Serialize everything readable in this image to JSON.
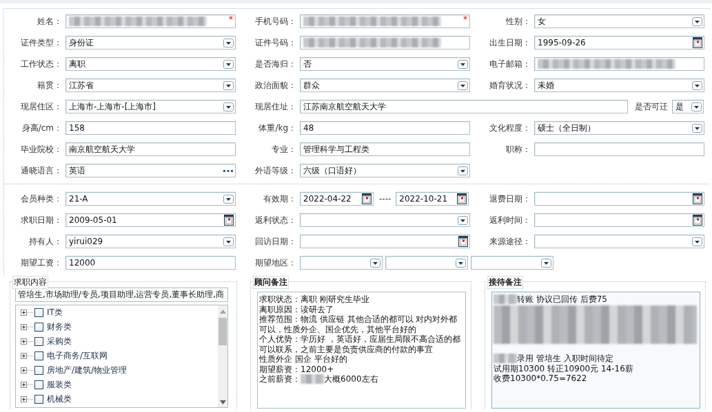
{
  "sections": [
    {
      "rows": [
        {
          "fields": [
            {
              "kind": "text",
              "label": "姓名：",
              "blurred": true,
              "required_mark": "*"
            },
            {
              "kind": "text",
              "label": "手机号码：",
              "blurred": true,
              "required_mark": "*"
            },
            {
              "kind": "select",
              "label": "性别：",
              "value": "女"
            }
          ]
        },
        {
          "fields": [
            {
              "kind": "select",
              "label": "证件类型：",
              "value": "身份证"
            },
            {
              "kind": "text",
              "label": "证件号码：",
              "blurred": true
            },
            {
              "kind": "date",
              "label": "出生日期：",
              "value": "1995-09-26"
            }
          ]
        },
        {
          "fields": [
            {
              "kind": "select",
              "label": "工作状态：",
              "value": "离职"
            },
            {
              "kind": "select",
              "label": "是否海归：",
              "value": "否"
            },
            {
              "kind": "text",
              "label": "电子邮箱：",
              "blurred": true
            }
          ]
        },
        {
          "fields": [
            {
              "kind": "select",
              "label": "籍贯：",
              "value": "江苏省"
            },
            {
              "kind": "select",
              "label": "政治面貌：",
              "value": "群众"
            },
            {
              "kind": "select",
              "label": "婚育状况：",
              "value": "未婚"
            }
          ]
        },
        {
          "fields": [
            {
              "kind": "select",
              "label": "现居住区：",
              "value": "上海市-上海市-[上海市]"
            },
            {
              "kind": "wide-text",
              "label": "现居住址：",
              "value": "江苏南京航空航天大学"
            },
            {
              "kind": "mini-select",
              "label": "是否可迁",
              "value": "是"
            }
          ]
        },
        {
          "fields": [
            {
              "kind": "text",
              "label": "身高/cm：",
              "value": "158"
            },
            {
              "kind": "text",
              "label": "体重/kg：",
              "value": "48"
            },
            {
              "kind": "select",
              "label": "文化程度：",
              "value": "硕士（全日制）"
            }
          ]
        },
        {
          "fields": [
            {
              "kind": "text",
              "label": "毕业院校：",
              "value": "南京航空航天大学"
            },
            {
              "kind": "text",
              "label": "专业：",
              "value": "管理科学与工程类"
            },
            {
              "kind": "text",
              "label": "职称："
            }
          ]
        },
        {
          "fields": [
            {
              "kind": "lookup",
              "label": "通晓语言：",
              "value": "英语"
            },
            {
              "kind": "select",
              "label": "外语等级：",
              "value": "六级（口语好）"
            }
          ]
        }
      ]
    },
    {
      "rows": [
        {
          "fields": [
            {
              "kind": "select",
              "label": "会员种类：",
              "value": "21-A"
            },
            {
              "kind": "date-range",
              "label": "有效期：",
              "value": "2022-04-22",
              "separator": "----",
              "value_end": "2022-10-21"
            },
            {
              "kind": "date",
              "label": "退费日期："
            }
          ]
        },
        {
          "fields": [
            {
              "kind": "date",
              "label": "求职日期：",
              "value": "2009-05-01"
            },
            {
              "kind": "select",
              "label": "返利状态："
            },
            {
              "kind": "date",
              "label": "返利时间："
            }
          ]
        },
        {
          "fields": [
            {
              "kind": "select",
              "label": "持有人：",
              "value": "yirui029"
            },
            {
              "kind": "date",
              "label": "回访日期："
            },
            {
              "kind": "select",
              "label": "来源途径："
            }
          ]
        },
        {
          "fields": [
            {
              "kind": "text",
              "label": "期望工资：",
              "value": "12000"
            },
            {
              "kind": "region",
              "label": "期望地区：",
              "parts": [
                {
                  "kind": "select"
                },
                {
                  "kind": "select"
                },
                {
                  "kind": "select"
                }
              ]
            }
          ]
        }
      ]
    }
  ],
  "job_panel": {
    "legend": "求职内容",
    "summary": "管培生,市场助理/专员,项目助理,运营专员,董事长助理,商",
    "categories": [
      {
        "label": "IT类",
        "expanded": false,
        "checked": false
      },
      {
        "label": "财务类",
        "expanded": false,
        "checked": false
      },
      {
        "label": "采购类",
        "expanded": false,
        "checked": false
      },
      {
        "label": "电子商务/互联网",
        "expanded": false,
        "checked": false
      },
      {
        "label": "房地产/建筑/物业管理",
        "expanded": false,
        "checked": false
      },
      {
        "label": "服装类",
        "expanded": false,
        "checked": false
      },
      {
        "label": "机械类",
        "expanded": false,
        "checked": false
      }
    ]
  },
  "advisor_notes": {
    "legend": "顾问备注",
    "lines": [
      {
        "kind": "text",
        "parts": [
          {
            "kind": "text",
            "text": "求职状态：离职 刚研究生毕业"
          }
        ]
      },
      {
        "kind": "text",
        "parts": [
          {
            "kind": "text",
            "text": "离职原因：读研去了"
          }
        ]
      },
      {
        "kind": "text",
        "parts": [
          {
            "kind": "text",
            "text": "推荐范围：物流 供应链 其他合适的都可以 对内对外都"
          }
        ]
      },
      {
        "kind": "text",
        "parts": [
          {
            "kind": "text",
            "text": "可以，性质外企、国企优先，其他平台好的"
          }
        ]
      },
      {
        "kind": "text",
        "parts": [
          {
            "kind": "text",
            "text": "个人优势：学历好 ，英语好，应届生局限不高合适的都"
          }
        ]
      },
      {
        "kind": "text",
        "parts": [
          {
            "kind": "text",
            "text": "可以联系，之前主要是负责供应商的付款的事宜"
          }
        ]
      },
      {
        "kind": "text",
        "parts": [
          {
            "kind": "text",
            "text": "性质外企 国企 平台好的"
          }
        ]
      },
      {
        "kind": "text",
        "parts": [
          {
            "kind": "text",
            "text": "期望薪资：12000+"
          }
        ]
      },
      {
        "kind": "text",
        "parts": [
          {
            "kind": "text",
            "text": "之前薪资："
          },
          {
            "kind": "blur"
          },
          {
            "kind": "text",
            "text": "大概6000左右"
          }
        ]
      }
    ]
  },
  "reception_notes": {
    "legend": "接待备注",
    "lines": [
      {
        "kind": "text",
        "parts": [
          {
            "kind": "blur"
          },
          {
            "kind": "text",
            "text": " 转账 协议已回传 后费75"
          }
        ]
      },
      {
        "kind": "blur-block"
      },
      {
        "kind": "blank"
      },
      {
        "kind": "text",
        "parts": [
          {
            "kind": "blur"
          },
          {
            "kind": "text",
            "text": "录用 管培生 入职时间待定"
          }
        ]
      },
      {
        "kind": "text",
        "parts": [
          {
            "kind": "text",
            "text": "试用期10300 转正10900元 14-16薪"
          }
        ]
      },
      {
        "kind": "text",
        "parts": [
          {
            "kind": "text",
            "text": "收费10300*0.75=7622"
          }
        ]
      }
    ]
  }
}
